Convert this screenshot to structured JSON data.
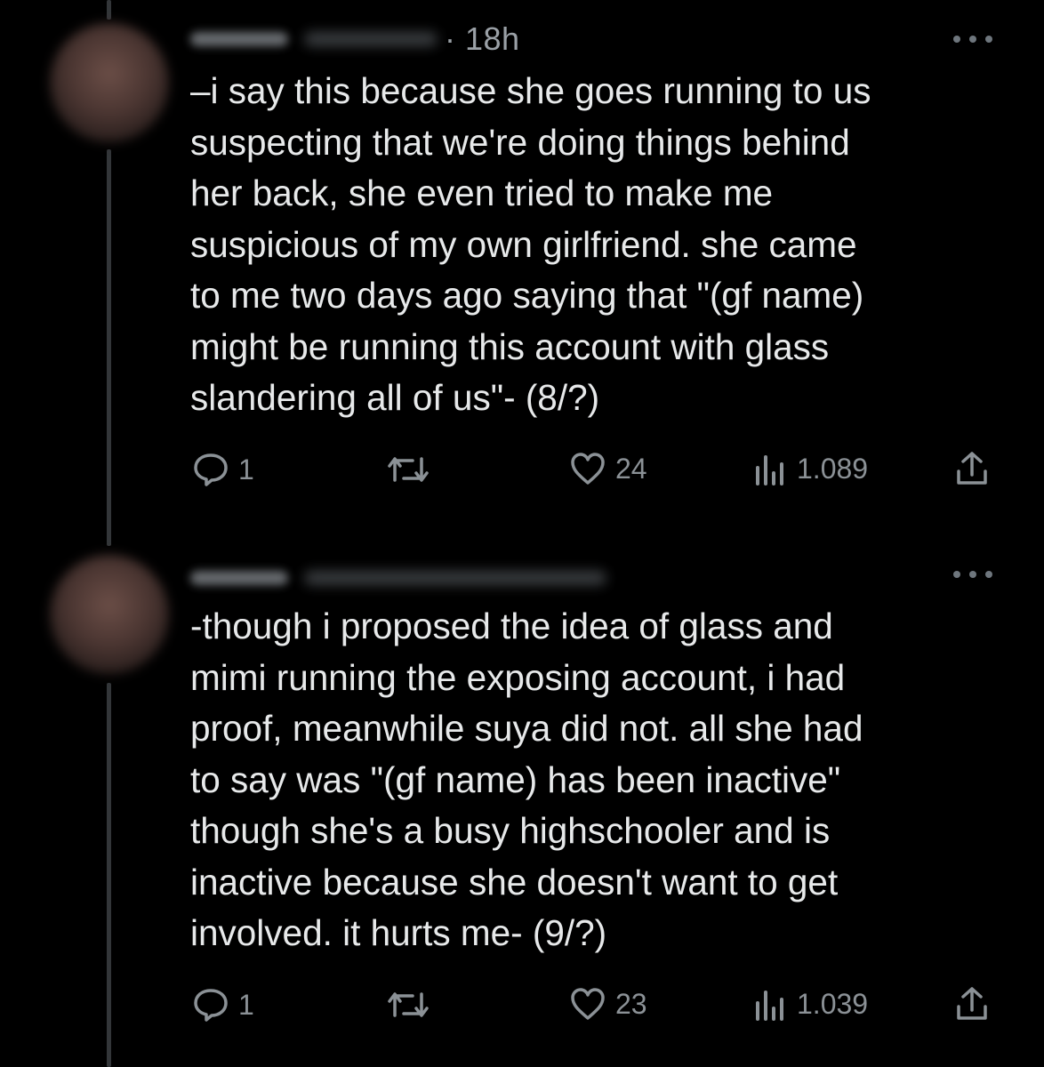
{
  "tweets": [
    {
      "time": "· 18h",
      "text": "–i say this because she goes running to us\nsuspecting that we're doing things behind\nher back, she even tried to make me\nsuspicious of my own girlfriend. she came\nto me two days ago saying that \"(gf name)\nmight be running this account with glass\nslandering all of us\"- (8/?)",
      "replies": "1",
      "retweets": "",
      "likes": "24",
      "views": "1.089"
    },
    {
      "time": "",
      "text": "-though i proposed the idea of glass and\nmimi running the exposing account, i had\nproof, meanwhile suya did not. all she had\nto say was \"(gf name) has been inactive\"\nthough she's a busy highschooler and is\ninactive because she doesn't want to get\ninvolved. it hurts me- (9/?)",
      "replies": "1",
      "retweets": "",
      "likes": "23",
      "views": "1.039"
    }
  ],
  "icons": {
    "reply": "reply-icon",
    "retweet": "retweet-icon",
    "like": "heart-icon",
    "views": "views-chart-icon",
    "share": "share-icon",
    "more": "more-dots-icon"
  },
  "colors": {
    "background": "#000000",
    "text": "#e7e9ea",
    "secondary": "#8b9196",
    "thread_line": "#333639"
  }
}
